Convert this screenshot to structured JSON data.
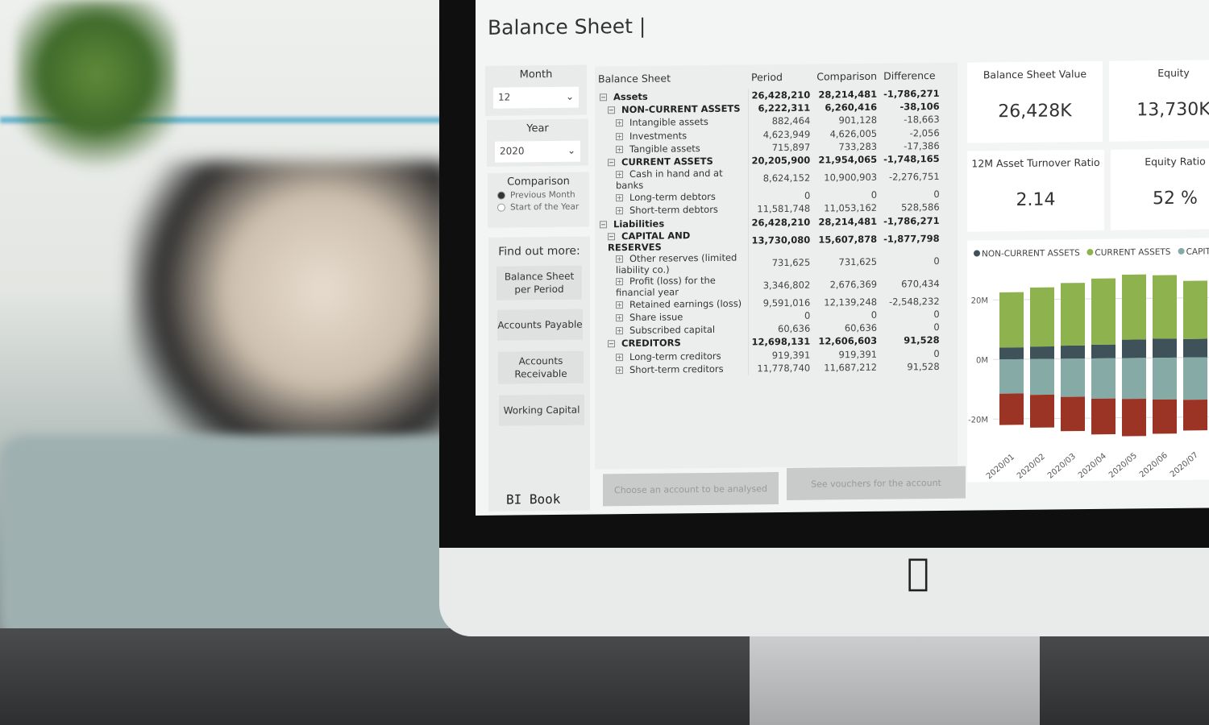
{
  "report": {
    "title": "Balance Sheet |"
  },
  "filters": {
    "month": {
      "label": "Month",
      "value": "12"
    },
    "year": {
      "label": "Year",
      "value": "2020"
    },
    "comparison": {
      "label": "Comparison",
      "options": [
        {
          "label": "Previous Month",
          "selected": true
        },
        {
          "label": "Start of the Year",
          "selected": false
        }
      ]
    }
  },
  "find_out": {
    "heading": "Find out more:",
    "links": [
      "Balance Sheet per Period",
      "Accounts Payable",
      "Accounts Receivable",
      "Working Capital"
    ]
  },
  "brand": "BI Book",
  "table": {
    "headers": [
      "Balance Sheet",
      "Period",
      "Comparison",
      "Difference"
    ],
    "rows": [
      {
        "label": "Assets",
        "level": 0,
        "bold": true,
        "expanded": true,
        "period": "26,428,210",
        "comparison": "28,214,481",
        "difference": "-1,786,271"
      },
      {
        "label": "NON-CURRENT ASSETS",
        "level": 1,
        "bold": true,
        "expanded": true,
        "period": "6,222,311",
        "comparison": "6,260,416",
        "difference": "-38,106"
      },
      {
        "label": "Intangible assets",
        "level": 2,
        "period": "882,464",
        "comparison": "901,128",
        "difference": "-18,663"
      },
      {
        "label": "Investments",
        "level": 2,
        "period": "4,623,949",
        "comparison": "4,626,005",
        "difference": "-2,056"
      },
      {
        "label": "Tangible assets",
        "level": 2,
        "period": "715,897",
        "comparison": "733,283",
        "difference": "-17,386"
      },
      {
        "label": "CURRENT ASSETS",
        "level": 1,
        "bold": true,
        "expanded": true,
        "period": "20,205,900",
        "comparison": "21,954,065",
        "difference": "-1,748,165"
      },
      {
        "label": "Cash in hand and at banks",
        "level": 2,
        "period": "8,624,152",
        "comparison": "10,900,903",
        "difference": "-2,276,751"
      },
      {
        "label": "Long-term debtors",
        "level": 2,
        "period": "0",
        "comparison": "0",
        "difference": "0"
      },
      {
        "label": "Short-term debtors",
        "level": 2,
        "period": "11,581,748",
        "comparison": "11,053,162",
        "difference": "528,586"
      },
      {
        "label": "Liabilities",
        "level": 0,
        "bold": true,
        "expanded": true,
        "period": "26,428,210",
        "comparison": "28,214,481",
        "difference": "-1,786,271"
      },
      {
        "label": "CAPITAL AND RESERVES",
        "level": 1,
        "bold": true,
        "expanded": true,
        "period": "13,730,080",
        "comparison": "15,607,878",
        "difference": "-1,877,798"
      },
      {
        "label": "Other reserves (limited liability co.)",
        "level": 2,
        "period": "731,625",
        "comparison": "731,625",
        "difference": "0"
      },
      {
        "label": "Profit (loss) for the financial year",
        "level": 2,
        "period": "3,346,802",
        "comparison": "2,676,369",
        "difference": "670,434"
      },
      {
        "label": "Retained earnings (loss)",
        "level": 2,
        "period": "9,591,016",
        "comparison": "12,139,248",
        "difference": "-2,548,232"
      },
      {
        "label": "Share issue",
        "level": 2,
        "period": "0",
        "comparison": "0",
        "difference": "0"
      },
      {
        "label": "Subscribed capital",
        "level": 2,
        "period": "60,636",
        "comparison": "60,636",
        "difference": "0"
      },
      {
        "label": "CREDITORS",
        "level": 1,
        "bold": true,
        "expanded": true,
        "period": "12,698,131",
        "comparison": "12,606,603",
        "difference": "91,528"
      },
      {
        "label": "Long-term creditors",
        "level": 2,
        "period": "919,391",
        "comparison": "919,391",
        "difference": "0"
      },
      {
        "label": "Short-term creditors",
        "level": 2,
        "period": "11,778,740",
        "comparison": "11,687,212",
        "difference": "91,528"
      }
    ]
  },
  "actions": {
    "choose": "Choose an account to be analysed",
    "vouchers": "See vouchers for the account"
  },
  "kpis": [
    {
      "label": "Balance Sheet Value",
      "value": "26,428K"
    },
    {
      "label": "Equity",
      "value": "13,730K"
    },
    {
      "label": "12M Asset Turnover Ratio",
      "value": "2.14"
    },
    {
      "label": "Equity Ratio",
      "value": "52 %"
    }
  ],
  "chart_data": {
    "type": "bar",
    "stacked": true,
    "categories": [
      "2020/01",
      "2020/02",
      "2020/03",
      "2020/04",
      "2020/05",
      "2020/06",
      "2020/07"
    ],
    "yticks": [
      "20M",
      "0M",
      "-20M"
    ],
    "ylim": [
      -25,
      30
    ],
    "grid": true,
    "legend": "top-left",
    "series": [
      {
        "name": "NON-CURRENT ASSETS",
        "color": "#3f5159",
        "values": [
          4.0,
          4.2,
          4.4,
          4.6,
          6.2,
          6.4,
          6.2
        ]
      },
      {
        "name": "CURRENT ASSETS",
        "color": "#8db24e",
        "values": [
          18.5,
          19.8,
          21.0,
          22.2,
          21.8,
          21.3,
          19.5
        ]
      },
      {
        "name": "CAPITAL",
        "color": "#86aaa6",
        "values": [
          -11.5,
          -12.0,
          -12.8,
          -13.5,
          -13.7,
          -14.0,
          -14.2
        ]
      },
      {
        "color": "#9b3424",
        "values": [
          -10.5,
          -11.0,
          -11.5,
          -12.0,
          -12.5,
          -11.5,
          -10.3
        ]
      }
    ]
  }
}
